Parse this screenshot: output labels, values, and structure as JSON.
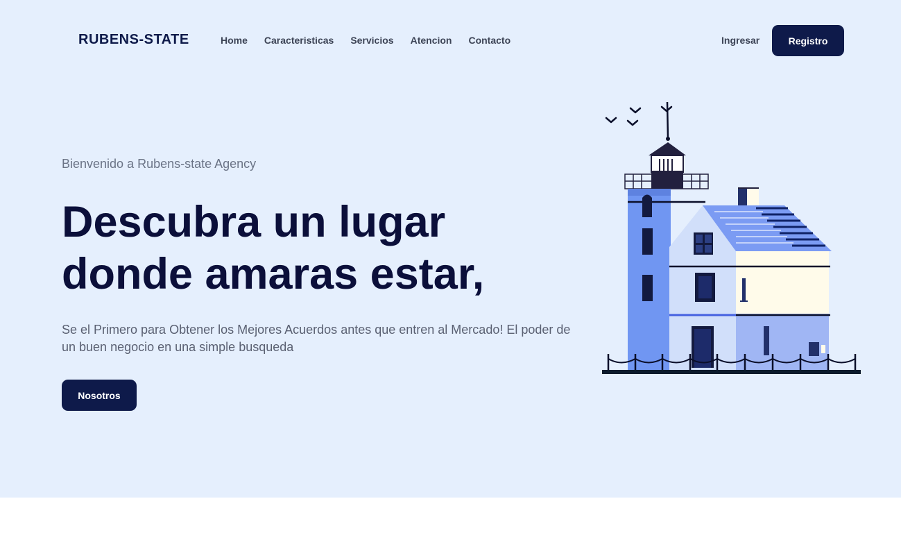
{
  "header": {
    "logo": "RUBENS-STATE",
    "nav": [
      "Home",
      "Caracteristicas",
      "Servicios",
      "Atencion",
      "Contacto"
    ],
    "login_label": "Ingresar",
    "register_label": "Registro"
  },
  "hero": {
    "welcome": "Bienvenido a Rubens-state Agency",
    "headline_line1": "Descubra un lugar",
    "headline_line2": "donde amaras estar,",
    "subtitle": "Se el Primero para Obtener los Mejores Acuerdos antes que entren al Mercado! El poder de un buen negocio en una simple busqueda",
    "cta_label": "Nosotros",
    "illustration": "lighthouse-house-illustration"
  },
  "colors": {
    "hero_bg": "#e5effd",
    "primary": "#0e1a4a",
    "heading": "#0b0f3a",
    "accent_blue": "#7096f2"
  }
}
